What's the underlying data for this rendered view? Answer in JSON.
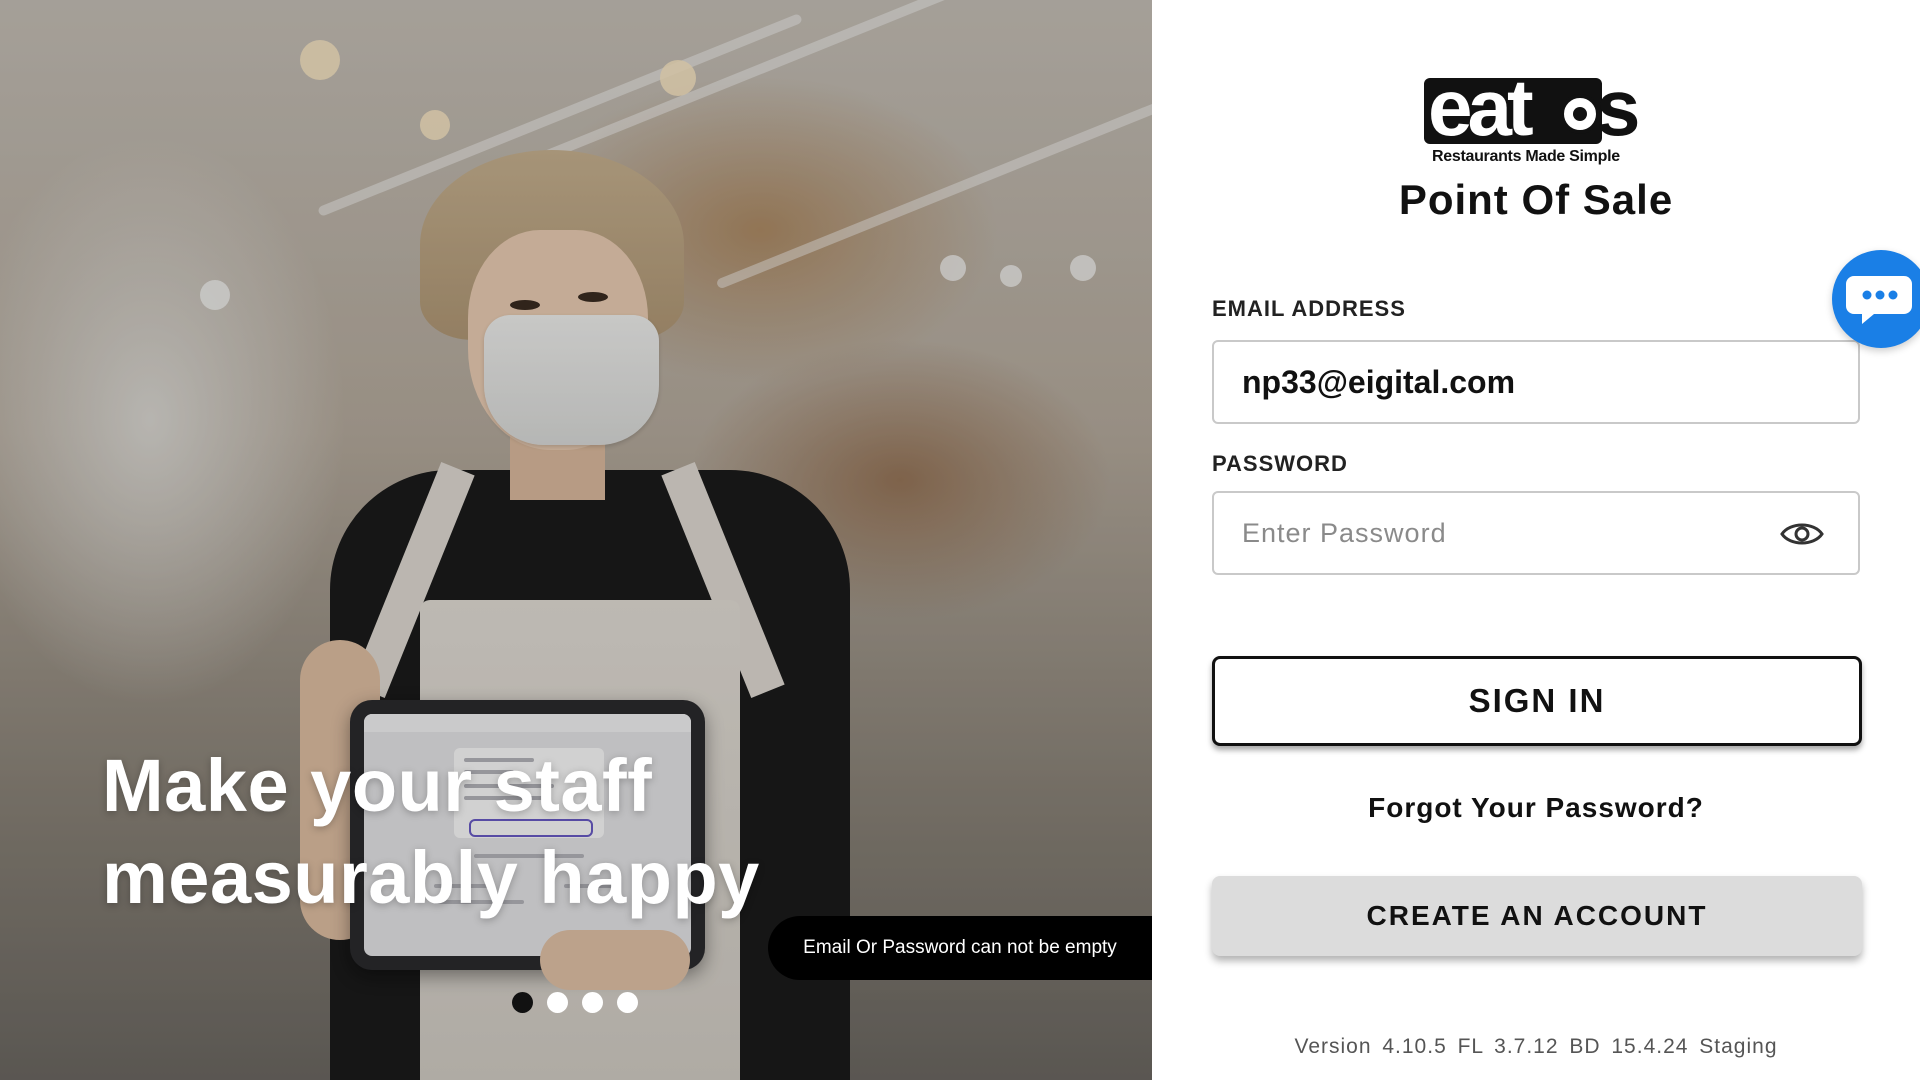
{
  "hero": {
    "headline_line1": "Make your staff",
    "headline_line2": "measurably happy",
    "carousel": {
      "total": 4,
      "active_index": 0
    }
  },
  "toast": {
    "message": "Email Or Password can not be empty"
  },
  "logo": {
    "word": "eatos",
    "tagline": "Restaurants Made Simple"
  },
  "app_title": "Point Of Sale",
  "email": {
    "label": "EMAIL ADDRESS",
    "value": "np33@eigital.com"
  },
  "password": {
    "label": "PASSWORD",
    "placeholder": "Enter Password",
    "value": ""
  },
  "buttons": {
    "sign_in": "SIGN IN",
    "forgot": "Forgot Your Password?",
    "create_account": "CREATE AN ACCOUNT"
  },
  "version_line": "Version 4.10.5   FL 3.7.12   BD 15.4.24   Staging",
  "icons": {
    "password_toggle": "eye-icon",
    "chat": "chat-bubble-icon"
  },
  "colors": {
    "chat_accent": "#1a7fe6",
    "toast_bg": "#000000",
    "create_button_bg": "#dcdcdc"
  }
}
